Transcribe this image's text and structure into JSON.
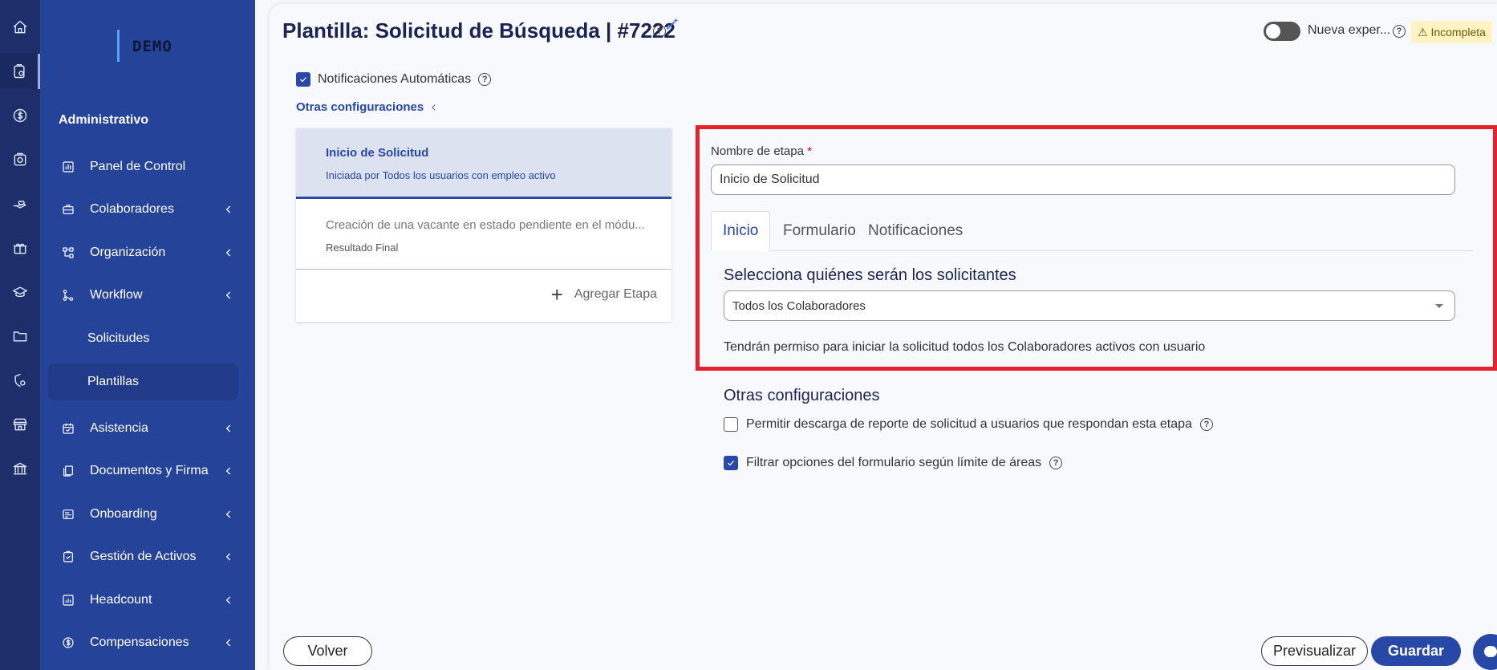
{
  "brand": {
    "logo_text": "DEMO"
  },
  "rail": {
    "icons": [
      "home-icon",
      "clipboard-icon",
      "dollar-icon",
      "safe-icon",
      "hand-heart-icon",
      "gift-icon",
      "graduation-cap-icon",
      "folder-icon",
      "shield-gear-icon",
      "store-icon",
      "bank-icon"
    ],
    "active_index": 1
  },
  "sidebar": {
    "section_title": "Administrativo",
    "items": [
      {
        "label": "Panel de Control",
        "icon": "chart-icon",
        "chevron": false
      },
      {
        "label": "Colaboradores",
        "icon": "briefcase-icon",
        "chevron": true
      },
      {
        "label": "Organización",
        "icon": "org-chart-icon",
        "chevron": true
      },
      {
        "label": "Workflow",
        "icon": "workflow-icon",
        "chevron": true
      },
      {
        "label": "Solicitudes",
        "sub": true
      },
      {
        "label": "Plantillas",
        "sub": true,
        "active": true
      },
      {
        "label": "Asistencia",
        "icon": "calendar-icon",
        "chevron": true
      },
      {
        "label": "Documentos y Firma",
        "icon": "documents-icon",
        "chevron": true
      },
      {
        "label": "Onboarding",
        "icon": "onboarding-icon",
        "chevron": true
      },
      {
        "label": "Gestión de Activos",
        "icon": "assets-icon",
        "chevron": true
      },
      {
        "label": "Headcount",
        "icon": "headcount-icon",
        "chevron": true
      },
      {
        "label": "Compensaciones",
        "icon": "compensation-icon",
        "chevron": true
      }
    ]
  },
  "header": {
    "title": "Plantilla: Solicitud de Búsqueda | #7222",
    "help_glyph": "?",
    "toggle_label": "Nueva exper...",
    "badge": "⚠ Incompleta"
  },
  "settings": {
    "notif_label": "Notificaciones Automáticas",
    "otras_link": "Otras configuraciones"
  },
  "stages": [
    {
      "title": "Inicio de Solicitud",
      "subtitle": "Iniciada por Todos los usuarios con empleo activo",
      "active": true
    },
    {
      "title": "Creación de una vacante en estado pendiente en el módu...",
      "subtitle": "Resultado Final",
      "active": false
    }
  ],
  "add_stage": {
    "plus": "+",
    "label": "Agregar Etapa"
  },
  "detail": {
    "nombre_label": "Nombre de etapa",
    "required_mark": "*",
    "nombre_value": "Inicio de Solicitud",
    "tabs": [
      "Inicio",
      "Formulario",
      "Notificaciones"
    ],
    "active_tab": 0,
    "select_title": "Selecciona quiénes serán los solicitantes",
    "select_value": "Todos los Colaboradores",
    "permission_text": "Tendrán permiso para iniciar la solicitud todos los Colaboradores activos con usuario",
    "otras_title": "Otras configuraciones",
    "options": [
      {
        "label": "Permitir descarga de reporte de solicitud a usuarios que respondan esta etapa",
        "checked": false
      },
      {
        "label": "Filtrar opciones del formulario según límite de áreas",
        "checked": true
      }
    ]
  },
  "footer": {
    "back": "Volver",
    "preview": "Previsualizar",
    "save": "Guardar"
  },
  "colors": {
    "primary": "#2748a6",
    "sidebar": "#26439a",
    "rail": "#1d2f6b",
    "highlight": "#e3222b",
    "badge_bg": "#fff3c4"
  }
}
